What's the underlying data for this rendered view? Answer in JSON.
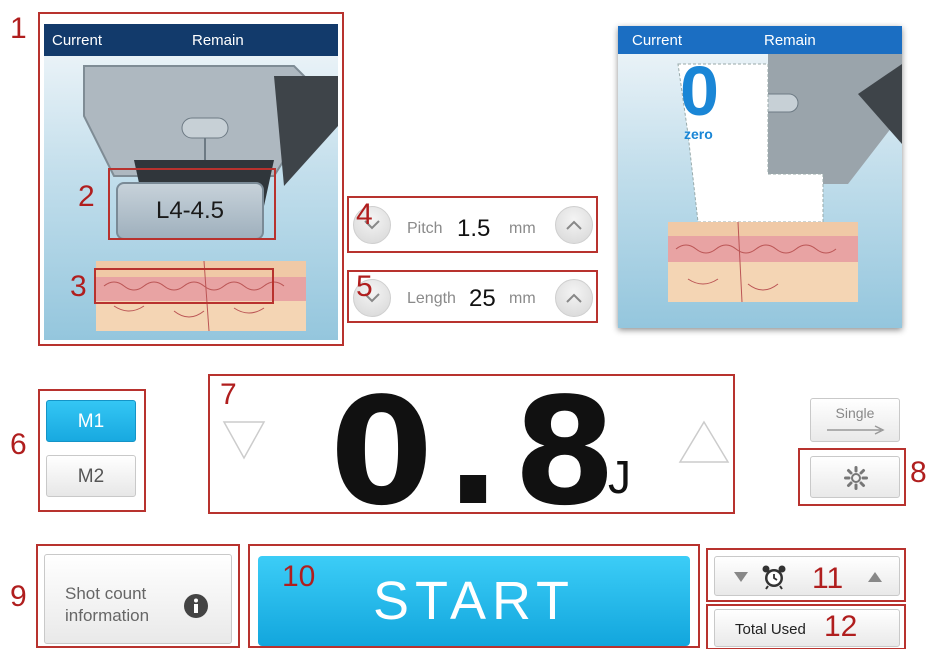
{
  "callouts": [
    "1",
    "2",
    "3",
    "4",
    "5",
    "6",
    "7",
    "8",
    "9",
    "10",
    "11",
    "12"
  ],
  "left_panel": {
    "current_label": "Current",
    "remain_label": "Remain",
    "cartridge": "L4-4.5"
  },
  "right_panel": {
    "current_label": "Current",
    "remain_label": "Remain",
    "count": "0",
    "count_caption": "zero"
  },
  "pitch": {
    "label": "Pitch",
    "value": "1.5",
    "unit": "mm"
  },
  "length": {
    "label": "Length",
    "value": "25",
    "unit": "mm"
  },
  "modes": {
    "m1": "M1",
    "m2": "M2",
    "selected": "M1"
  },
  "energy": {
    "value": "0.8",
    "unit": "J"
  },
  "single_button": "Single",
  "shot_count": {
    "label": "Shot count information"
  },
  "start_button": "START",
  "total_used": "Total Used",
  "colors": {
    "accent": "#18a9e0",
    "header": "#123a6b",
    "callout": "#b8322e"
  }
}
